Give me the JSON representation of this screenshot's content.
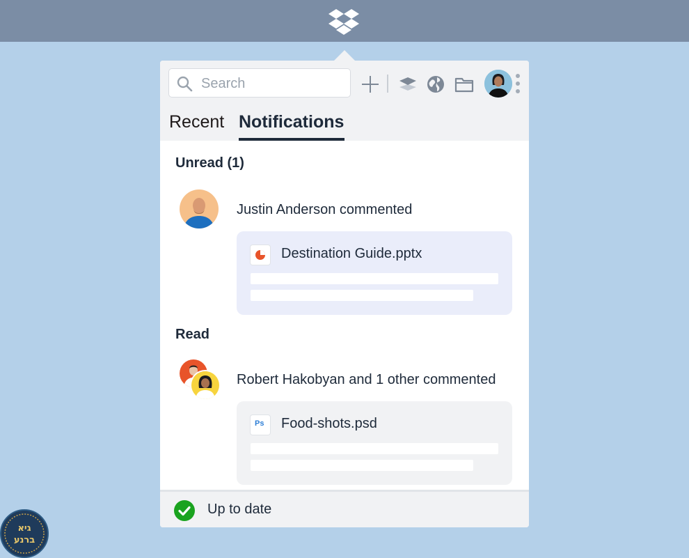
{
  "app": {
    "name": "Dropbox"
  },
  "toolbar": {
    "search_placeholder": "Search",
    "icons": [
      "plus-icon",
      "layers-icon",
      "globe-icon",
      "folder-icon",
      "more-icon"
    ]
  },
  "tabs": [
    {
      "label": "Recent",
      "active": false
    },
    {
      "label": "Notifications",
      "active": true
    }
  ],
  "sections": {
    "unread": {
      "title": "Unread (1)",
      "items": [
        {
          "text": "Justin Anderson commented",
          "file": "Destination Guide.pptx",
          "file_icon": "pptx-icon"
        }
      ]
    },
    "read": {
      "title": "Read",
      "items": [
        {
          "text": "Robert Hakobyan and 1 other commented",
          "file": "Food-shots.psd",
          "file_icon": "psd-icon",
          "file_icon_text": "Ps"
        }
      ]
    }
  },
  "status": {
    "text": "Up to date"
  },
  "badge": {
    "text": "גיא ברנע"
  },
  "colors": {
    "topbar": "#7b8da5",
    "background": "#b4d0e9",
    "unread_card": "#eaedfa",
    "read_card": "#f1f2f4",
    "success": "#1aa31f",
    "pptx": "#e8542a"
  }
}
